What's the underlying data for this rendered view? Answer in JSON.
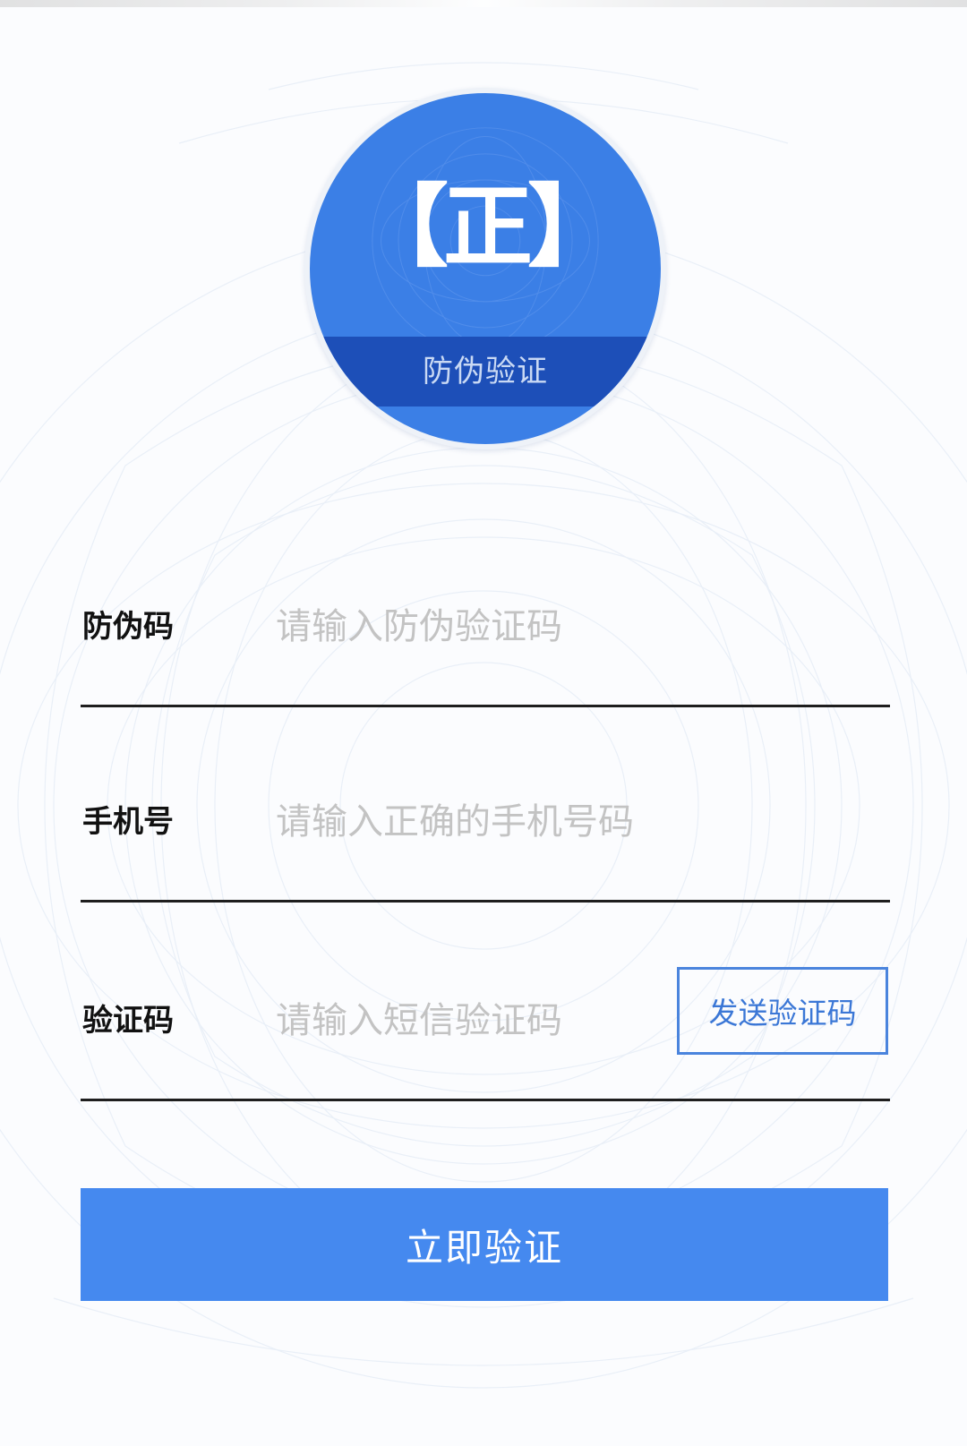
{
  "logo": {
    "symbol": "【正】",
    "band_text": "防伪验证",
    "icon": "anti-counterfeit-seal-icon",
    "colors": {
      "circle": "#3b7fe6",
      "band": "#1d4fb8"
    }
  },
  "form": {
    "code": {
      "label": "防伪码",
      "placeholder": "请输入防伪验证码"
    },
    "phone": {
      "label": "手机号",
      "placeholder": "请输入正确的手机号码"
    },
    "sms": {
      "label": "验证码",
      "placeholder": "请输入短信验证码",
      "send_button": "发送验证码"
    }
  },
  "actions": {
    "verify_label": "立即验证"
  },
  "colors": {
    "accent": "#4589ef",
    "link": "#3b77d6"
  }
}
